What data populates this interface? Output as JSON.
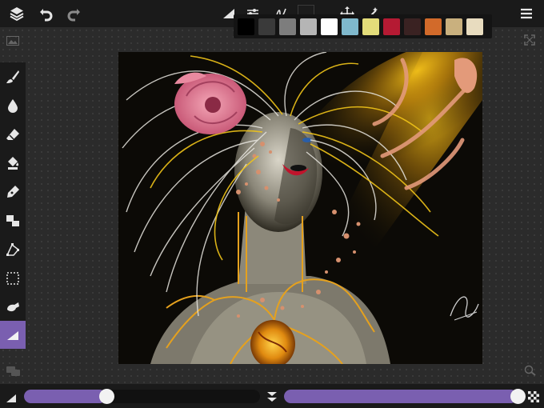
{
  "toolbar": {
    "layers_icon": "layers-icon",
    "undo_icon": "undo-icon",
    "redo_icon": "redo-icon",
    "brush_shape_icon": "brush-shape-icon",
    "adjust_icon": "sliders-icon",
    "stroke_icon": "stroke-style-icon",
    "transform_icon": "move-icon",
    "magic_icon": "magic-wand-icon",
    "menu_icon": "hamburger-menu-icon",
    "current_color": "#1c1c1c"
  },
  "palette": {
    "swatches": [
      "#000000",
      "#3a3a3a",
      "#7d7d7d",
      "#b5b5b5",
      "#ffffff",
      "#7fb8cc",
      "#e3dc7a",
      "#b51a33",
      "#3a2222",
      "#d26a2a",
      "#c9b07e",
      "#e8dcbf"
    ]
  },
  "left_tools": [
    {
      "name": "brush-tool",
      "icon": "brush-icon",
      "active": false
    },
    {
      "name": "blur-tool",
      "icon": "droplet-icon",
      "active": false
    },
    {
      "name": "eraser-tool",
      "icon": "eraser-icon",
      "active": false
    },
    {
      "name": "fill-tool",
      "icon": "paint-bucket-icon",
      "active": false
    },
    {
      "name": "pen-tool",
      "icon": "pen-nib-icon",
      "active": false
    },
    {
      "name": "shape-tool",
      "icon": "shapes-icon",
      "active": false
    },
    {
      "name": "transform-tool",
      "icon": "perspective-icon",
      "active": false
    },
    {
      "name": "select-tool",
      "icon": "selection-marquee-icon",
      "active": false
    },
    {
      "name": "smudge-tool",
      "icon": "smudge-icon",
      "active": false
    },
    {
      "name": "brush-settings-tool",
      "icon": "triangle-brush-icon",
      "active": true
    }
  ],
  "sliders": {
    "size_value": 0.35,
    "opacity_value": 0.98
  },
  "colors": {
    "accent": "#7a5fb0"
  }
}
